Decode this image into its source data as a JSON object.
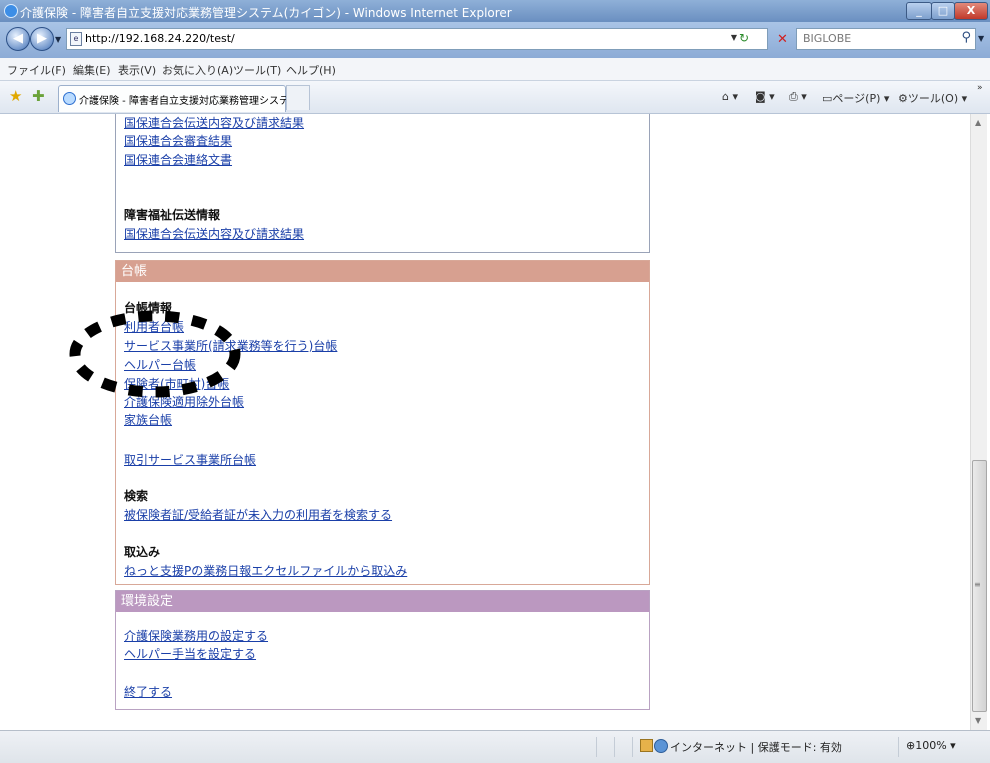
{
  "window": {
    "title": "介護保険 - 障害者自立支援対応業務管理システム(カイゴン) - Windows Internet Explorer",
    "buttons": {
      "minimize": "_",
      "maximize": "□",
      "close": "X"
    }
  },
  "address_bar": {
    "url": "http://192.168.24.220/test/",
    "search_placeholder": "BIGLOBE"
  },
  "menu": [
    "ファイル(F)",
    "編集(E)",
    "表示(V)",
    "お気に入り(A)",
    "ツール(T)",
    "ヘルプ(H)"
  ],
  "tab": {
    "title": "介護保険 - 障害者自立支援対応業務管理システ..."
  },
  "command_bar": {
    "page": "ページ(P)",
    "tools": "ツール(O)"
  },
  "panel1": {
    "links_top": [
      "国保連合会伝送内容及び請求結果",
      "国保連合会審査結果",
      "国保連合会連絡文書"
    ],
    "welfare_heading": "障害福祉伝送情報",
    "welfare_link": "国保連合会伝送内容及び請求結果"
  },
  "ledger": {
    "header": "台帳",
    "info_heading": "台帳情報",
    "info_links": [
      "利用者台帳",
      "サービス事業所(請求業務等を行う)台帳",
      "ヘルパー台帳",
      "保険者(市町村)台帳",
      "介護保険適用除外台帳",
      "家族台帳"
    ],
    "trading_link": "取引サービス事業所台帳",
    "search_heading": "検索",
    "search_link": "被保険者証/受給者証が未入力の利用者を検索する",
    "import_heading": "取込み",
    "import_link": "ねっと支援Pの業務日報エクセルファイルから取込み"
  },
  "settings": {
    "header": "環境設定",
    "links": [
      "介護保険業務用の設定する",
      "ヘルパー手当を設定する"
    ],
    "exit_link": "終了する"
  },
  "status_bar": {
    "zone": "インターネット | 保護モード: 有効",
    "zoom": "100%"
  }
}
